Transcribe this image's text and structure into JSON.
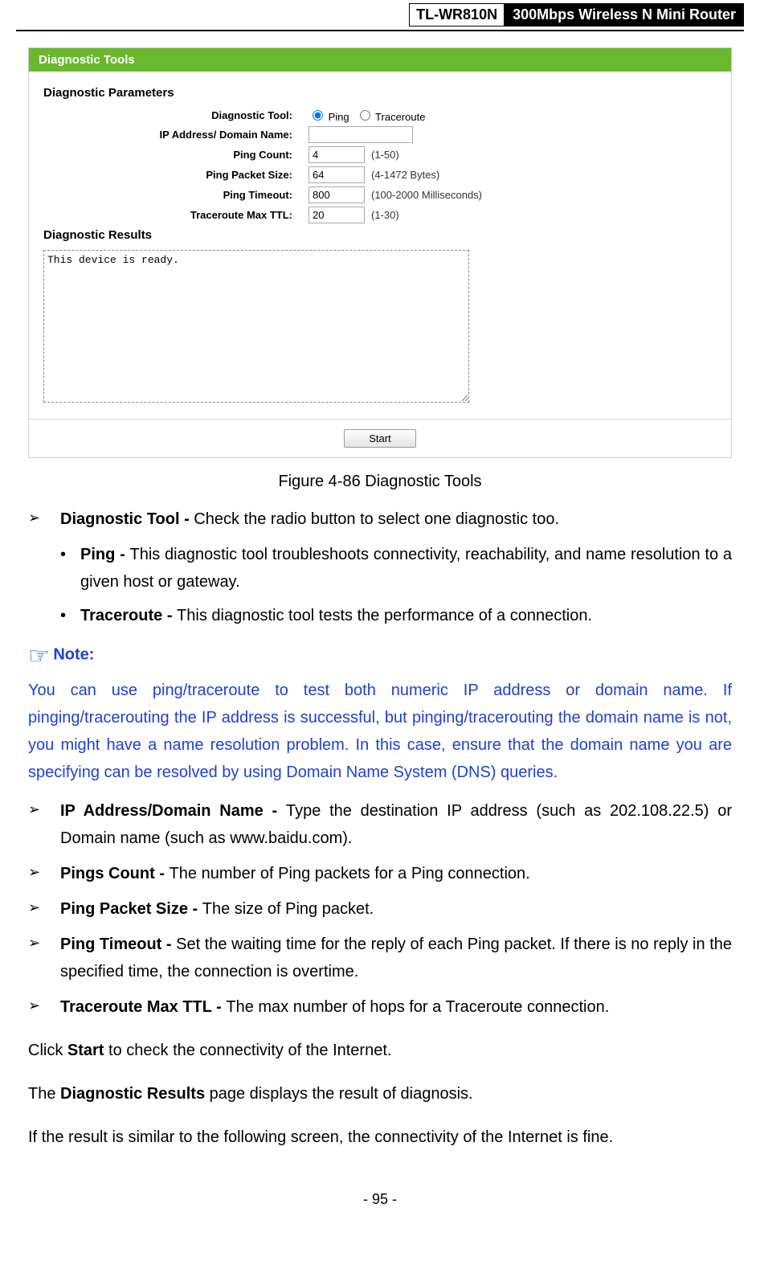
{
  "header": {
    "model": "TL-WR810N",
    "product": "300Mbps Wireless N Mini Router"
  },
  "panel": {
    "title": "Diagnostic Tools",
    "paramsTitle": "Diagnostic Parameters",
    "rows": {
      "tool": {
        "label": "Diagnostic Tool:",
        "opt1": "Ping",
        "opt2": "Traceroute"
      },
      "ip": {
        "label": "IP Address/ Domain Name:",
        "value": ""
      },
      "count": {
        "label": "Ping Count:",
        "value": "4",
        "hint": "(1-50)"
      },
      "size": {
        "label": "Ping Packet Size:",
        "value": "64",
        "hint": "(4-1472 Bytes)"
      },
      "timeout": {
        "label": "Ping Timeout:",
        "value": "800",
        "hint": "(100-2000 Milliseconds)"
      },
      "ttl": {
        "label": "Traceroute Max TTL:",
        "value": "20",
        "hint": "(1-30)"
      }
    },
    "resultsTitle": "Diagnostic Results",
    "resultsText": "This device is ready.",
    "startButton": "Start"
  },
  "figureCaption": "Figure 4-86 Diagnostic Tools",
  "bullets": {
    "diagTool": {
      "bold": "Diagnostic Tool - ",
      "text": "Check the radio button to select one diagnostic too."
    },
    "ping": {
      "bold": "Ping - ",
      "text": "This diagnostic tool troubleshoots connectivity, reachability, and name resolution to a given host or gateway."
    },
    "trace": {
      "bold": "Traceroute - ",
      "text": "This diagnostic tool tests the performance of a connection."
    }
  },
  "note": {
    "label": "Note:",
    "body": "You can use ping/traceroute to test both numeric IP address or domain name. If pinging/tracerouting the IP address is successful, but pinging/tracerouting the domain name is not, you might have a name resolution problem. In this case, ensure that the domain name you are specifying can be resolved by using Domain Name System (DNS) queries."
  },
  "bullets2": {
    "ip": {
      "bold": "IP Address/Domain Name - ",
      "text": "Type the destination IP address (such as 202.108.22.5) or Domain name (such as www.baidu.com)."
    },
    "count": {
      "bold": "Pings Count - ",
      "text": "The number of Ping packets for a Ping connection."
    },
    "size": {
      "bold": "Ping Packet Size - ",
      "text": "The size of Ping packet."
    },
    "timeout": {
      "bold": "Ping Timeout - ",
      "text": "Set the waiting time for the reply of each Ping packet. If there is no reply in the specified time, the connection is overtime."
    },
    "ttl": {
      "bold": "Traceroute Max TTL - ",
      "text": "The max number of hops for a Traceroute connection."
    }
  },
  "para1": {
    "pre": "Click ",
    "bold": "Start",
    "post": " to check the connectivity of the Internet."
  },
  "para2": {
    "pre": "The ",
    "bold": "Diagnostic Results",
    "post": " page displays the result of diagnosis."
  },
  "para3": "If the result is similar to the following screen, the connectivity of the Internet is fine.",
  "pageNum": "- 95 -"
}
